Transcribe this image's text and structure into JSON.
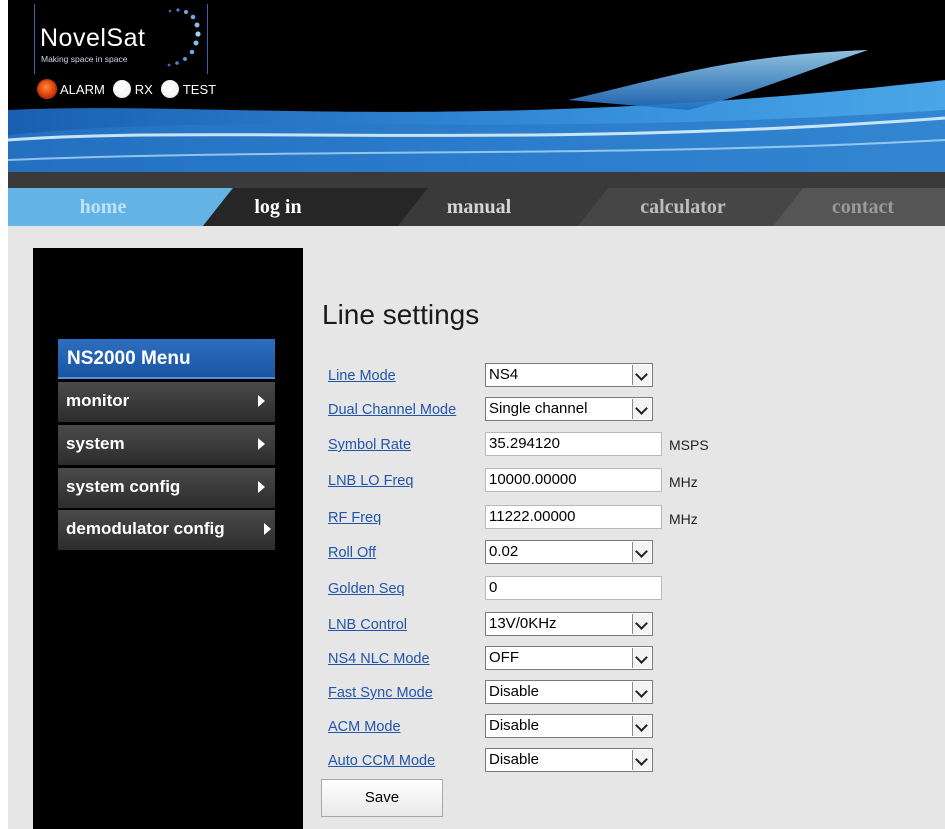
{
  "brand": {
    "name": "NovelSat",
    "tagline": "Making space in space",
    "colors": {
      "accent": "#1a55a3",
      "link": "#2255aa",
      "sidebar": "#000000"
    }
  },
  "indicators": [
    {
      "label": "ALARM",
      "state": "on",
      "color": "#e0400a"
    },
    {
      "label": "RX",
      "state": "off",
      "color": "#ffffff"
    },
    {
      "label": "TEST",
      "state": "off",
      "color": "#ffffff"
    }
  ],
  "nav": {
    "items": [
      {
        "label": "home",
        "active": true
      },
      {
        "label": "log in",
        "active": false
      },
      {
        "label": "manual",
        "active": false
      },
      {
        "label": "calculator",
        "active": false
      },
      {
        "label": "contact",
        "active": false
      }
    ]
  },
  "menu": {
    "title": "NS2000 Menu",
    "items": [
      {
        "label": "monitor"
      },
      {
        "label": "system"
      },
      {
        "label": "system config"
      },
      {
        "label": "demodulator config"
      }
    ]
  },
  "page": {
    "title": "Line settings",
    "fields": [
      {
        "label": "Line Mode",
        "type": "select",
        "value": "NS4",
        "unit": ""
      },
      {
        "label": "Dual Channel Mode",
        "type": "select",
        "value": "Single channel",
        "unit": ""
      },
      {
        "label": "Symbol Rate",
        "type": "text",
        "value": "35.294120",
        "unit": "MSPS"
      },
      {
        "label": "LNB LO Freq",
        "type": "text",
        "value": "10000.00000",
        "unit": "MHz"
      },
      {
        "label": "RF Freq",
        "type": "text",
        "value": "11222.00000",
        "unit": "MHz"
      },
      {
        "label": "Roll Off",
        "type": "select",
        "value": "0.02",
        "unit": ""
      },
      {
        "label": "Golden Seq",
        "type": "text",
        "value": "0",
        "unit": ""
      },
      {
        "label": "LNB Control",
        "type": "select",
        "value": "13V/0KHz",
        "unit": ""
      },
      {
        "label": "NS4 NLC Mode",
        "type": "select",
        "value": "OFF",
        "unit": ""
      },
      {
        "label": "Fast Sync Mode",
        "type": "select",
        "value": "Disable",
        "unit": ""
      },
      {
        "label": "ACM Mode",
        "type": "select",
        "value": "Disable",
        "unit": ""
      },
      {
        "label": "Auto CCM Mode",
        "type": "select",
        "value": "Disable",
        "unit": ""
      }
    ],
    "save_label": "Save"
  }
}
